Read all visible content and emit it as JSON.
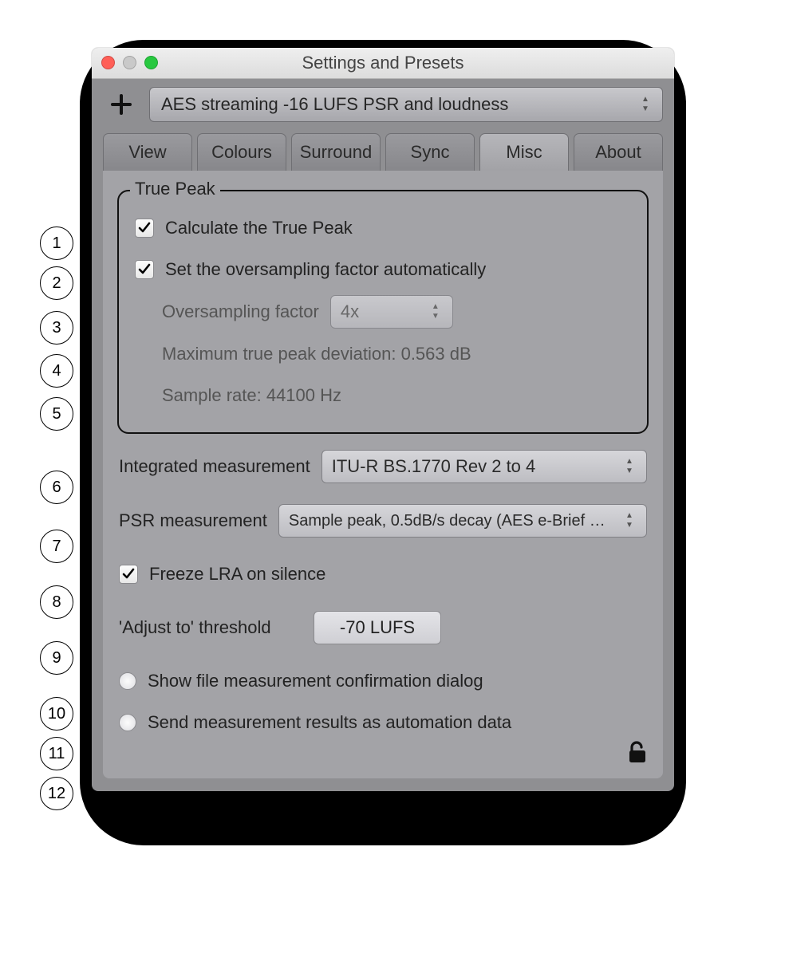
{
  "window_title": "Settings and Presets",
  "preset": {
    "selected": "AES streaming -16 LUFS PSR and loudness"
  },
  "tabs": [
    "View",
    "Colours",
    "Surround",
    "Sync",
    "Misc",
    "About"
  ],
  "active_tab_index": 4,
  "truepeak": {
    "legend": "True Peak",
    "calc_label": "Calculate the True Peak",
    "calc_checked": true,
    "auto_label": "Set the oversampling factor automatically",
    "auto_checked": true,
    "ovs_label": "Oversampling factor",
    "ovs_value": "4x",
    "max_dev_label": "Maximum true peak deviation: 0.563 dB",
    "sr_label": "Sample rate: 44100 Hz"
  },
  "integrated": {
    "label": "Integrated measurement",
    "value": "ITU-R BS.1770 Rev 2 to 4"
  },
  "psr": {
    "label": "PSR measurement",
    "value": "Sample peak, 0.5dB/s decay (AES e-Brief …"
  },
  "freeze": {
    "label": "Freeze LRA on silence",
    "checked": true
  },
  "adjust": {
    "label": "'Adjust to' threshold",
    "value": "-70 LUFS"
  },
  "show_dialog": {
    "label": "Show file measurement confirmation dialog",
    "checked": false
  },
  "send_auto": {
    "label": "Send measurement results as automation data",
    "checked": false
  },
  "annotations": [
    "1",
    "2",
    "3",
    "4",
    "5",
    "6",
    "7",
    "8",
    "9",
    "10",
    "11",
    "12"
  ]
}
